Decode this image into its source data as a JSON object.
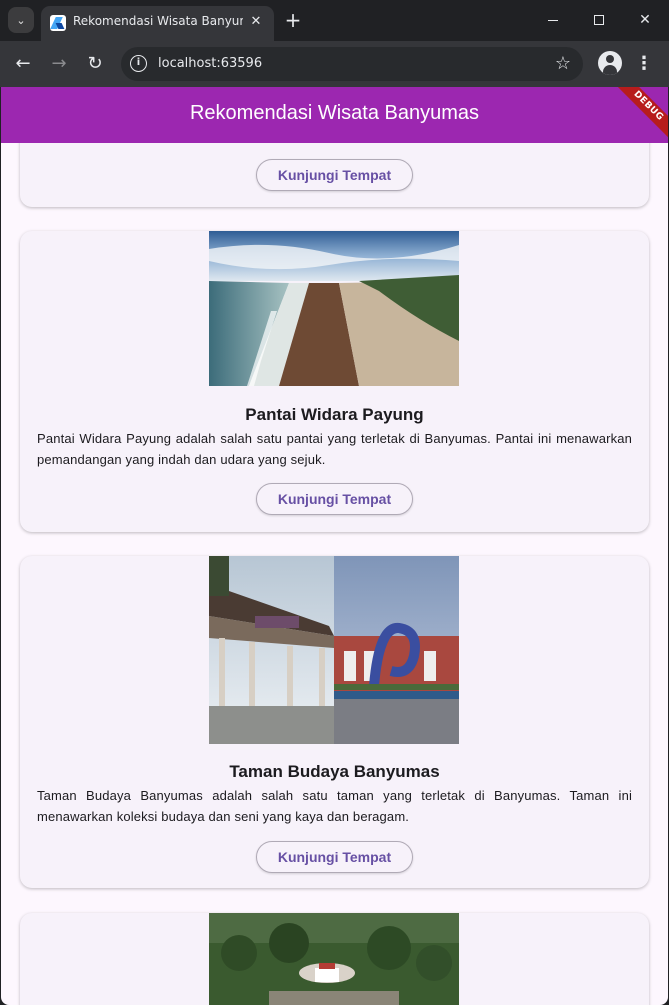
{
  "browser": {
    "tab_title": "Rekomendasi Wisata Banyumas",
    "tab_close": "✕",
    "new_tab": "+",
    "url": "localhost:63596",
    "site_info_icon": "i",
    "star_icon": "☆",
    "menu_icon": "⋮",
    "back_icon": "←",
    "forward_icon": "→",
    "reload_icon": "↻",
    "tab_menu_icon": "⌄",
    "close_window_icon": "✕"
  },
  "app": {
    "title": "Rekomendasi Wisata Banyumas",
    "debug_banner": "DEBUG",
    "accent": "#9c27b0",
    "button_color": "#6750a4"
  },
  "places": [
    {
      "title": "",
      "description": "",
      "button": "Kunjungi Tempat"
    },
    {
      "title": "Pantai Widara Payung",
      "description": "Pantai Widara Payung adalah salah satu pantai yang terletak di Banyumas. Pantai ini menawarkan pemandangan yang indah dan udara yang sejuk.",
      "button": "Kunjungi Tempat"
    },
    {
      "title": "Taman Budaya Banyumas",
      "description": "Taman Budaya Banyumas adalah salah satu taman yang terletak di Banyumas. Taman ini menawarkan koleksi budaya dan seni yang kaya dan beragam.",
      "button": "Kunjungi Tempat"
    }
  ]
}
